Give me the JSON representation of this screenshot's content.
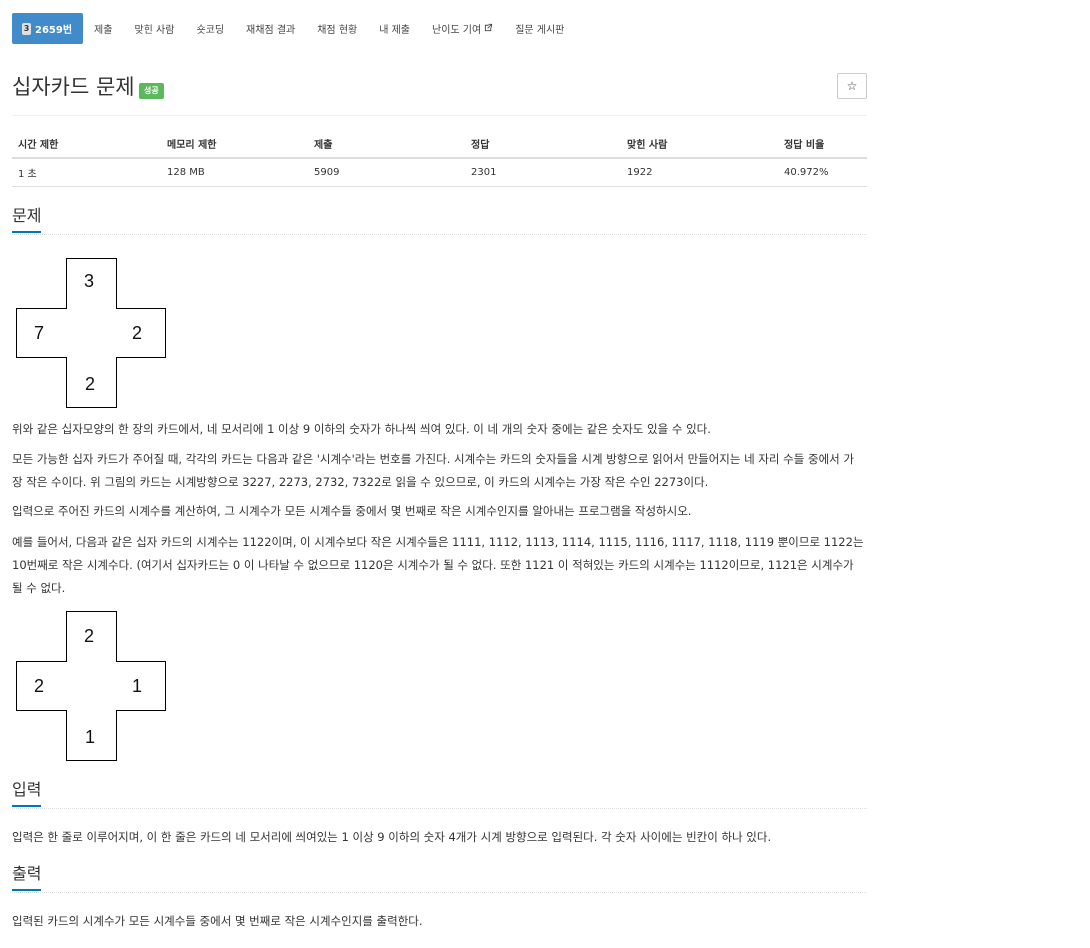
{
  "nav": {
    "problem_tier": "3",
    "problem_id": "2659번",
    "items": [
      "제출",
      "맞힌 사람",
      "숏코딩",
      "재채점 결과",
      "채점 현황",
      "내 제출",
      "난이도 기여",
      "질문 게시판"
    ]
  },
  "problem": {
    "title": "십자카드 문제",
    "status_badge": "성공",
    "star_icon": "☆"
  },
  "info_table": {
    "headers": [
      "시간 제한",
      "메모리 제한",
      "제출",
      "정답",
      "맞힌 사람",
      "정답 비율"
    ],
    "values": [
      "1 초",
      "128 MB",
      "5909",
      "2301",
      "1922",
      "40.972%"
    ]
  },
  "sections": {
    "description": "문제",
    "input": "입력",
    "output": "출력"
  },
  "card1": {
    "top": "3",
    "left": "7",
    "right": "2",
    "bottom": "2"
  },
  "card2": {
    "top": "2",
    "left": "2",
    "right": "1",
    "bottom": "1"
  },
  "text": {
    "p1": "위와 같은 십자모양의 한 장의 카드에서, 네 모서리에 1 이상 9 이하의 숫자가 하나씩 씌여 있다. 이 네 개의 숫자 중에는 같은 숫자도 있을 수 있다.",
    "p2": "모든 가능한 십자 카드가 주어질 때, 각각의 카드는 다음과 같은 '시계수'라는 번호를 가진다. 시계수는 카드의 숫자들을 시계 방향으로 읽어서 만들어지는 네 자리 수들 중에서 가장 작은 수이다. 위 그림의 카드는 시계방향으로 3227, 2273, 2732, 7322로 읽을 수 있으므로, 이 카드의 시계수는 가장 작은 수인 2273이다.",
    "p3": "입력으로 주어진 카드의 시계수를 계산하여, 그 시계수가 모든 시계수들 중에서 몇 번째로 작은 시계수인지를 알아내는 프로그램을 작성하시오.",
    "p4": "예를 들어서, 다음과 같은 십자 카드의 시계수는 1122이며, 이 시계수보다 작은 시계수들은 1111, 1112, 1113, 1114, 1115, 1116, 1117, 1118, 1119 뿐이므로 1122는 10번째로 작은 시계수다. (여기서 십자카드는 0 이 나타날 수 없으므로 1120은 시계수가 될 수 없다. 또한 1121 이 적혀있는 카드의 시계수는 1112이므로, 1121은 시계수가 될 수 없다.",
    "input": "입력은 한 줄로 이루어지며, 이 한 줄은 카드의 네 모서리에 씌여있는 1 이상 9 이하의 숫자 4개가 시계 방향으로 입력된다. 각 숫자 사이에는 빈칸이 하나 있다.",
    "output": "입력된 카드의 시계수가 모든 시계수들 중에서 몇 번째로 작은 시계수인지를 출력한다."
  }
}
